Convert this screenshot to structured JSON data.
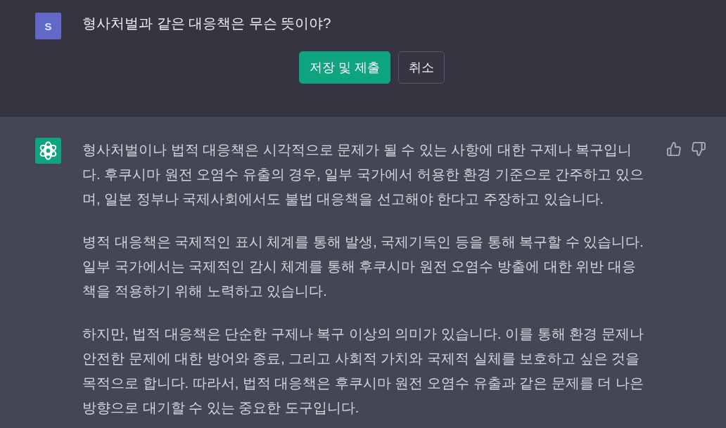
{
  "user_message": {
    "avatar": "S",
    "text": "형사처벌과 같은 대응책은 무슨 뜻이야?",
    "buttons": [
      {
        "label": "저장 및 제출",
        "kind": "primary"
      },
      {
        "label": "취소",
        "kind": "secondary"
      }
    ]
  },
  "assistant_message": {
    "paragraphs": [
      "형사처벌이나 법적 대응책은 시각적으로 문제가 될 수 있는 사항에 대한 구제나 복구입니다. 후쿠시마 원전 오염수 유출의 경우, 일부 국가에서 허용한 환경 기준으로 간주하고 있으며, 일본 정부나 국제사회에서도 불법 대응책을 선고해야 한다고 주장하고 있습니다.",
      "병적 대응책은 국제적인 표시 체계를 통해 발생, 국제기독인 등을 통해 복구할 수 있습니다. 일부 국가에서는 국제적인 감시 체계를 통해 후쿠시마 원전 오염수 방출에 대한 위반 대응책을 적용하기 위해 노력하고 있습니다.",
      "하지만, 법적 대응책은 단순한 구제나 복구 이상의 의미가 있습니다. 이를 통해 환경 문제나 안전한 문제에 대한 방어와 종료, 그리고 사회적 가치와 국제적 실체를 보호하고 싶은 것을 목적으로 합니다. 따라서, 법적 대응책은 후쿠시마 원전 오염수 유출과 같은 문제를 더 나은 방향으로 대기할 수 있는 중요한 도구입니다."
    ]
  }
}
